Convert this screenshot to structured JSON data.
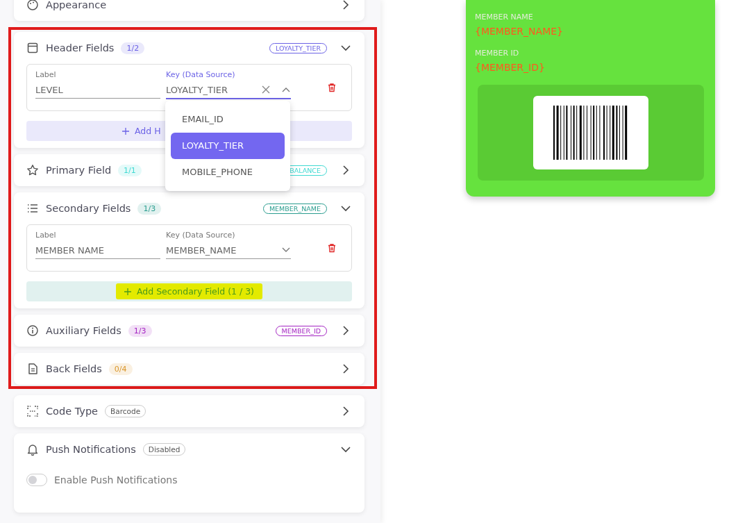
{
  "sections": [
    {
      "kind": "section",
      "title": "Appearance",
      "expanded": false
    },
    {
      "kind": "annotation_frame",
      "sections": [
        {
          "kind": "section",
          "title": "Header Fields",
          "count": "1/2",
          "color": "#6c63e6",
          "tag": "LOYALTY_TIER",
          "expanded": true,
          "fields": [
            {
              "label_caption": "Label",
              "label_value": "LEVEL",
              "key_caption": "Key (Data Source)",
              "key_value": "LOYALTY_TIER",
              "open": true,
              "options": [
                {
                  "label": "EMAIL_ID",
                  "selected": false
                },
                {
                  "label": "LOYALTY_TIER",
                  "selected": true
                },
                {
                  "label": "MOBILE_PHONE",
                  "selected": false
                }
              ]
            }
          ],
          "add_button": {
            "text": "Add H",
            "highlighted": false
          }
        },
        {
          "kind": "section",
          "title": "Primary Field",
          "count": "1/1",
          "color": "#3fd9d2",
          "tag": "BALANCE",
          "expanded": false
        },
        {
          "kind": "section",
          "title": "Secondary Fields",
          "count": "1/3",
          "color": "#2a9d8f",
          "tag": "MEMBER_NAME",
          "expanded": true,
          "fields": [
            {
              "label_caption": "Label",
              "label_value": "MEMBER NAME",
              "key_caption": "Key (Data Source)",
              "key_value": "MEMBER_NAME",
              "open": false
            }
          ],
          "add_button": {
            "text": "Add Secondary Field (1 / 3)",
            "highlighted": true
          }
        },
        {
          "kind": "section",
          "title": "Auxiliary Fields",
          "count": "1/3",
          "color": "#a424c2",
          "tag": "MEMBER_ID",
          "expanded": false
        },
        {
          "kind": "section",
          "title": "Back Fields",
          "count": "0/4",
          "color": "#d9962a",
          "expanded": false
        }
      ]
    },
    {
      "kind": "section",
      "title": "Code Type",
      "status": "Barcode",
      "expanded": false
    },
    {
      "kind": "section",
      "title": "Push Notifications",
      "status": "Disabled",
      "expanded": true,
      "toggle": {
        "label": "Enable Push Notifications",
        "on": false
      }
    }
  ],
  "pass": {
    "fields": [
      {
        "label": "MEMBER NAME",
        "value": "{MEMBER_NAME}"
      },
      {
        "label": "MEMBER ID",
        "value": "{MEMBER_ID}"
      }
    ]
  }
}
